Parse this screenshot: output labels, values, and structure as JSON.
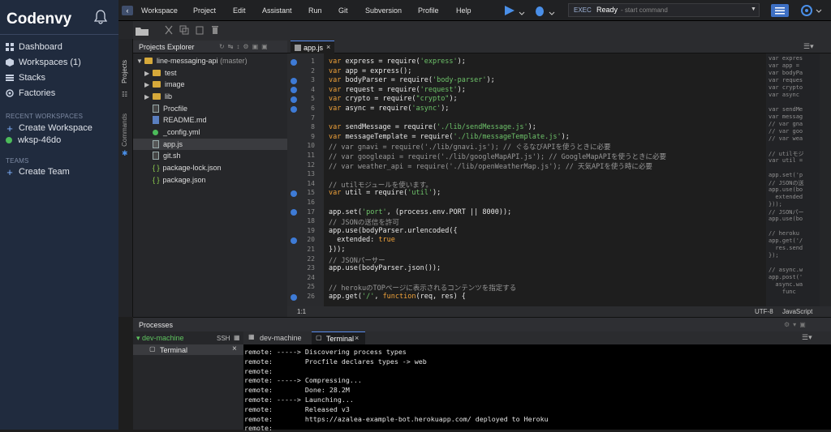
{
  "nav": {
    "brand": "Codenvy",
    "items": [
      {
        "label": "Dashboard"
      },
      {
        "label": "Workspaces (1)"
      },
      {
        "label": "Stacks"
      },
      {
        "label": "Factories"
      }
    ],
    "recent_title": "RECENT WORKSPACES",
    "create_ws": "Create Workspace",
    "ws": "wksp-46do",
    "teams_title": "TEAMS",
    "create_team": "Create Team"
  },
  "menu": [
    "Workspace",
    "Project",
    "Edit",
    "Assistant",
    "Run",
    "Git",
    "Subversion",
    "Profile",
    "Help"
  ],
  "exec": {
    "label": "EXEC",
    "status": "Ready",
    "placeholder": "- start command"
  },
  "sidetabs": [
    "Projects",
    "Commands"
  ],
  "projects": {
    "title": "Projects Explorer",
    "root": "line-messaging-api",
    "branch": "(master)",
    "items": [
      "test",
      "image",
      "lib",
      "Procfile",
      "README.md",
      "_config.yml",
      "app.js",
      "git.sh",
      "package-lock.json",
      "package.json"
    ]
  },
  "editor": {
    "tab": "app.js",
    "position": "1:1",
    "encoding": "UTF-8",
    "language": "JavaScript",
    "line_numbers": [
      "1",
      "2",
      "3",
      "4",
      "5",
      "6",
      "7",
      "8",
      "9",
      "10",
      "11",
      "12",
      "13",
      "14",
      "15",
      "16",
      "17",
      "18",
      "19",
      "20",
      "21",
      "22",
      "23",
      "24",
      "25",
      "26"
    ],
    "bp_numbers": [
      "1",
      "3",
      "4",
      "5",
      "6",
      "15",
      "17",
      "20",
      "26"
    ],
    "lines": [
      "var express = require('express');",
      "var app = express();",
      "var bodyParser = require('body-parser');",
      "var request = require('request');",
      "var crypto = require(\"crypto\");",
      "var async = require('async');",
      "",
      "var sendMessage = require('./lib/sendMessage.js');",
      "var messageTemplate = require('./lib/messageTemplate.js');",
      "// var gnavi = require('./lib/gnavi.js'); // ぐるなびAPIを使うときに必要",
      "// var googleapi = require('./lib/googleMapAPI.js'); // GoogleMapAPIを使うときに必要",
      "// var weather_api = require('./lib/openWeatherMap.js'); // 天気APIを使う時に必要",
      "",
      "// utilモジュールを使います。",
      "var util = require('util');",
      "",
      "app.set('port', (process.env.PORT || 8000));",
      "// JSONの送信を許可",
      "app.use(bodyParser.urlencoded({",
      "  extended: true",
      "}));",
      "// JSONパーサー",
      "app.use(bodyParser.json());",
      "",
      "// herokuのTOPページに表示されるコンテンツを指定する",
      "app.get('/', function(req, res) {"
    ],
    "minimap": [
      "var expres",
      "var app =",
      "var bodyPa",
      "var reques",
      "var crypto",
      "var async",
      "",
      "var sendMe",
      "var messag",
      "// var gna",
      "// var goo",
      "// var wea",
      "",
      "// utilモジ",
      "var util =",
      "",
      "app.set('p",
      "// JSONの送",
      "app.use(bo",
      "  extended",
      "}));",
      "// JSONパー",
      "app.use(bo",
      "",
      "// heroku",
      "app.get('/",
      "  res.send",
      "});",
      "",
      "// async.w",
      "app.post('",
      "  async.wa",
      "    func"
    ]
  },
  "processes": {
    "title": "Processes",
    "machine": "dev-machine",
    "ssh": "SSH",
    "terminal": "Terminal",
    "tab_machine": "dev-machine",
    "tab_terminal": "Terminal",
    "lines": [
      "remote: -----> Discovering process types",
      "remote:        Procfile declares types -> web",
      "remote: ",
      "remote: -----> Compressing...",
      "remote:        Done: 28.2M",
      "remote: -----> Launching...",
      "remote:        Released v3",
      "remote:        https://azalea-example-bot.herokuapp.com/ deployed to Heroku",
      "remote: "
    ]
  }
}
